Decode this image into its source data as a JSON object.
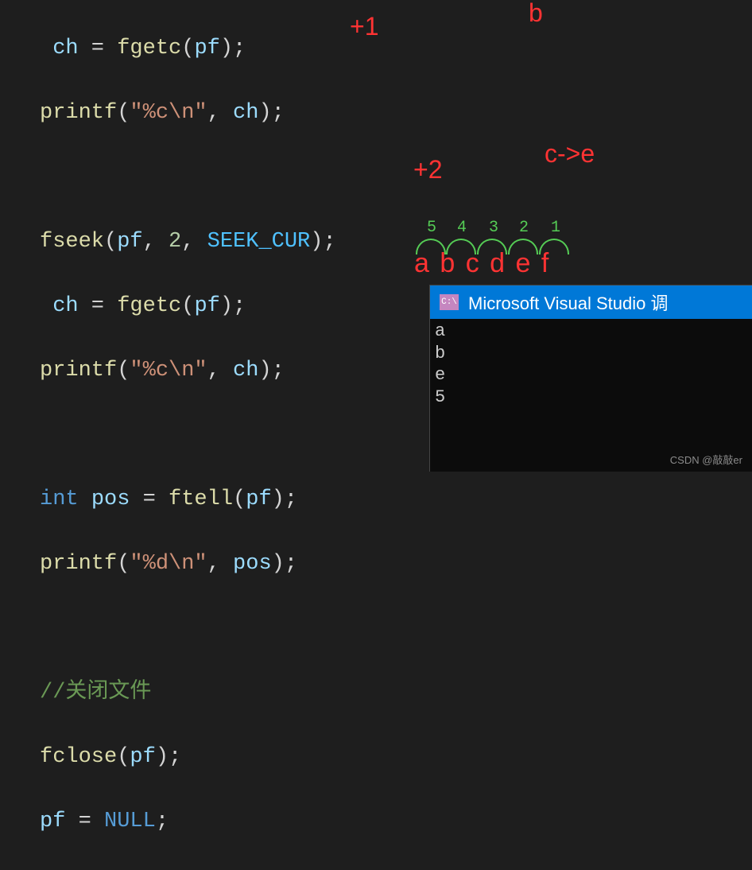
{
  "code": {
    "line1": {
      "indent": " ",
      "var": "ch",
      "op": " = ",
      "func": "fgetc",
      "p1": "(",
      "arg": "pf",
      "p2": ");"
    },
    "line2": {
      "func": "printf",
      "p1": "(",
      "str": "\"%c\\n\"",
      "comma": ", ",
      "arg": "ch",
      "p2": ");"
    },
    "line4": {
      "func": "fseek",
      "p1": "(",
      "a1": "pf",
      "c1": ", ",
      "a2": "2",
      "c2": ", ",
      "a3": "SEEK_CUR",
      "p2": ");"
    },
    "line5": {
      "indent": " ",
      "var": "ch",
      "op": " = ",
      "func": "fgetc",
      "p1": "(",
      "arg": "pf",
      "p2": ");"
    },
    "line6": {
      "func": "printf",
      "p1": "(",
      "str": "\"%c\\n\"",
      "comma": ", ",
      "arg": "ch",
      "p2": ");"
    },
    "line8": {
      "kw": "int",
      "sp": " ",
      "var": "pos",
      "op": " = ",
      "func": "ftell",
      "p1": "(",
      "arg": "pf",
      "p2": ");"
    },
    "line9": {
      "func": "printf",
      "p1": "(",
      "str": "\"%d\\n\"",
      "comma": ", ",
      "arg": "pos",
      "p2": ");"
    },
    "line11": {
      "comment": "//关闭文件"
    },
    "line12": {
      "func": "fclose",
      "p1": "(",
      "arg": "pf",
      "p2": ");"
    },
    "line13": {
      "var": "pf",
      "op": " = ",
      "val": "NULL",
      "semi": ";"
    }
  },
  "annotations": {
    "plus1": "+1",
    "b": "b",
    "plus2": "+2",
    "ce": "c->e",
    "arc_numbers": {
      "n5": "5",
      "n4": "4",
      "n3": "3",
      "n2": "2",
      "n1": "1"
    },
    "letters": "a b c d e f"
  },
  "console": {
    "icon": "C:\\",
    "title": "Microsoft Visual Studio 调",
    "output": [
      "a",
      "b",
      "e",
      "5"
    ]
  },
  "watermark": "CSDN @敲敲er"
}
